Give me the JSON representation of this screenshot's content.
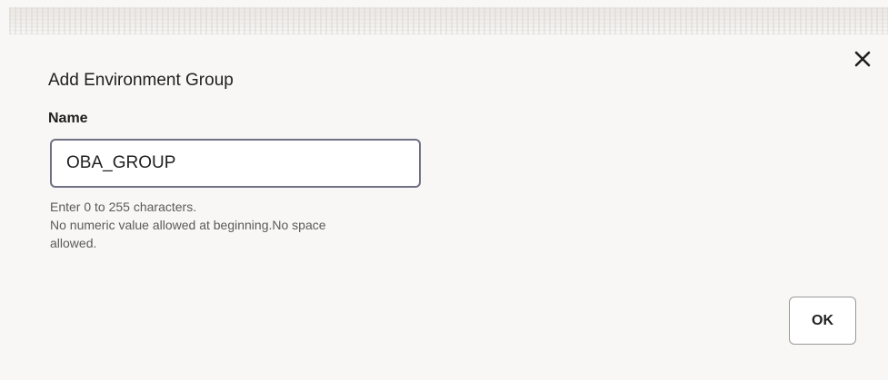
{
  "dialog": {
    "title": "Add Environment Group",
    "name_label": "Name",
    "name_value": "OBA_GROUP",
    "help_lines": [
      "Enter 0 to 255 characters.",
      "No numeric value allowed at beginning.No space",
      "allowed."
    ],
    "ok_label": "OK",
    "close_icon": "close-icon"
  }
}
